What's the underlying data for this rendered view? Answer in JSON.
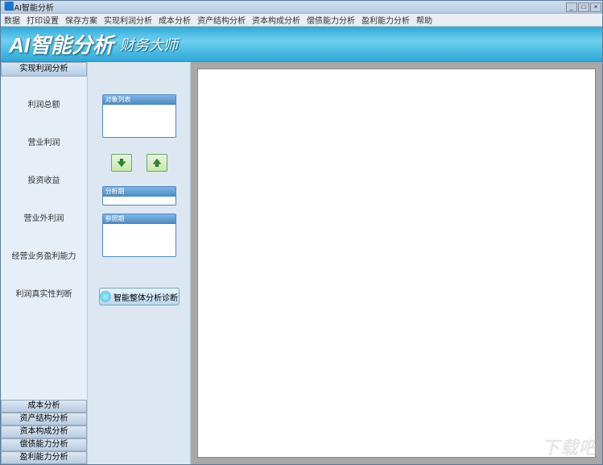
{
  "window": {
    "title": "AI智能分析"
  },
  "winControls": {
    "min": "_",
    "max": "□",
    "close": "×"
  },
  "menu": [
    "数据",
    "打印设置",
    "保存方案",
    "实现利润分析",
    "成本分析",
    "资产结构分析",
    "资本构成分析",
    "偿债能力分析",
    "盈利能力分析",
    "帮助"
  ],
  "banner": {
    "logo": "AI智能分析",
    "sub": "财务大师"
  },
  "left": {
    "top": "实现利润分析",
    "items": [
      "利润总额",
      "营业利润",
      "投资收益",
      "营业外利润",
      "经营业务盈利能力",
      "利润真实性判断"
    ],
    "bottom": [
      "成本分析",
      "资产结构分析",
      "资本构成分析",
      "偿债能力分析",
      "盈利能力分析"
    ]
  },
  "mid": {
    "panel1": "对象列表",
    "panel2": "分析期",
    "panel3": "参照期",
    "bigbtn": "智能整体分析诊断"
  },
  "watermark": "下载吧"
}
